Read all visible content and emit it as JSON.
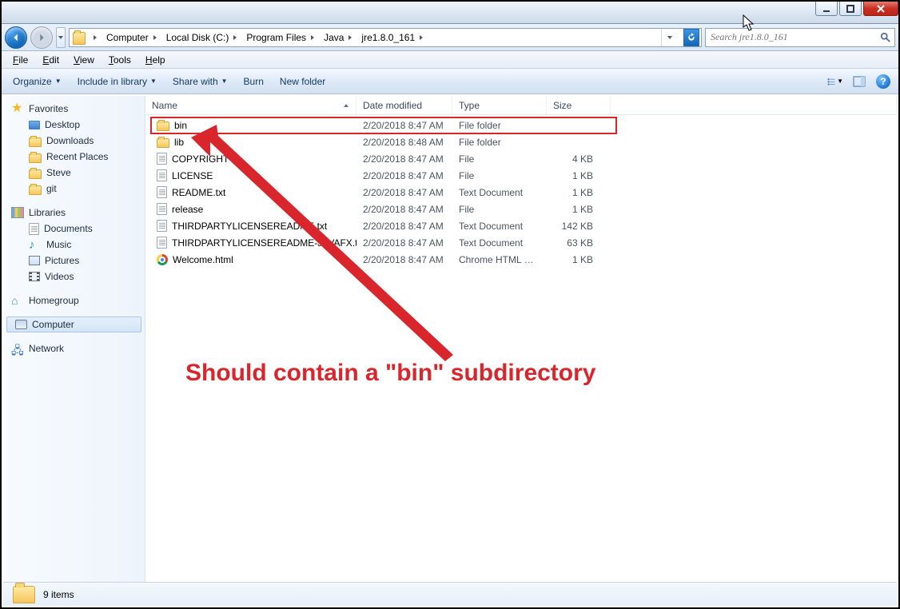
{
  "window_controls": {
    "minimize": "minimize",
    "maximize": "maximize",
    "close": "close"
  },
  "breadcrumbs": [
    "Computer",
    "Local Disk (C:)",
    "Program Files",
    "Java",
    "jre1.8.0_161"
  ],
  "search": {
    "placeholder": "Search jre1.8.0_161"
  },
  "menubar": {
    "file": "File",
    "edit": "Edit",
    "view": "View",
    "tools": "Tools",
    "help": "Help"
  },
  "toolbar": {
    "organize": "Organize",
    "include": "Include in library",
    "share": "Share with",
    "burn": "Burn",
    "newfolder": "New folder"
  },
  "sidebar": {
    "favorites": {
      "heading": "Favorites",
      "items": [
        {
          "label": "Desktop",
          "icon": "desktop"
        },
        {
          "label": "Downloads",
          "icon": "folder"
        },
        {
          "label": "Recent Places",
          "icon": "folder"
        },
        {
          "label": "Steve",
          "icon": "folder"
        },
        {
          "label": "git",
          "icon": "folder"
        }
      ]
    },
    "libraries": {
      "heading": "Libraries",
      "items": [
        {
          "label": "Documents",
          "icon": "file"
        },
        {
          "label": "Music",
          "icon": "music"
        },
        {
          "label": "Pictures",
          "icon": "pic"
        },
        {
          "label": "Videos",
          "icon": "vid"
        }
      ]
    },
    "homegroup": {
      "heading": "Homegroup"
    },
    "computer": {
      "heading": "Computer"
    },
    "network": {
      "heading": "Network"
    }
  },
  "columns": {
    "name": "Name",
    "date": "Date modified",
    "type": "Type",
    "size": "Size"
  },
  "files": [
    {
      "name": "bin",
      "date": "2/20/2018 8:47 AM",
      "type": "File folder",
      "size": "",
      "icon": "folder"
    },
    {
      "name": "lib",
      "date": "2/20/2018 8:48 AM",
      "type": "File folder",
      "size": "",
      "icon": "folder"
    },
    {
      "name": "COPYRIGHT",
      "date": "2/20/2018 8:47 AM",
      "type": "File",
      "size": "4 KB",
      "icon": "file"
    },
    {
      "name": "LICENSE",
      "date": "2/20/2018 8:47 AM",
      "type": "File",
      "size": "1 KB",
      "icon": "file"
    },
    {
      "name": "README.txt",
      "date": "2/20/2018 8:47 AM",
      "type": "Text Document",
      "size": "1 KB",
      "icon": "file"
    },
    {
      "name": "release",
      "date": "2/20/2018 8:47 AM",
      "type": "File",
      "size": "1 KB",
      "icon": "file"
    },
    {
      "name": "THIRDPARTYLICENSEREADME.txt",
      "date": "2/20/2018 8:47 AM",
      "type": "Text Document",
      "size": "142 KB",
      "icon": "file"
    },
    {
      "name": "THIRDPARTYLICENSEREADME-JAVAFX.txt",
      "date": "2/20/2018 8:47 AM",
      "type": "Text Document",
      "size": "63 KB",
      "icon": "file"
    },
    {
      "name": "Welcome.html",
      "date": "2/20/2018 8:47 AM",
      "type": "Chrome HTML Do...",
      "size": "1 KB",
      "icon": "chrome"
    }
  ],
  "status": {
    "count": "9 items"
  },
  "annotation": {
    "text": "Should contain a \"bin\" subdirectory"
  }
}
